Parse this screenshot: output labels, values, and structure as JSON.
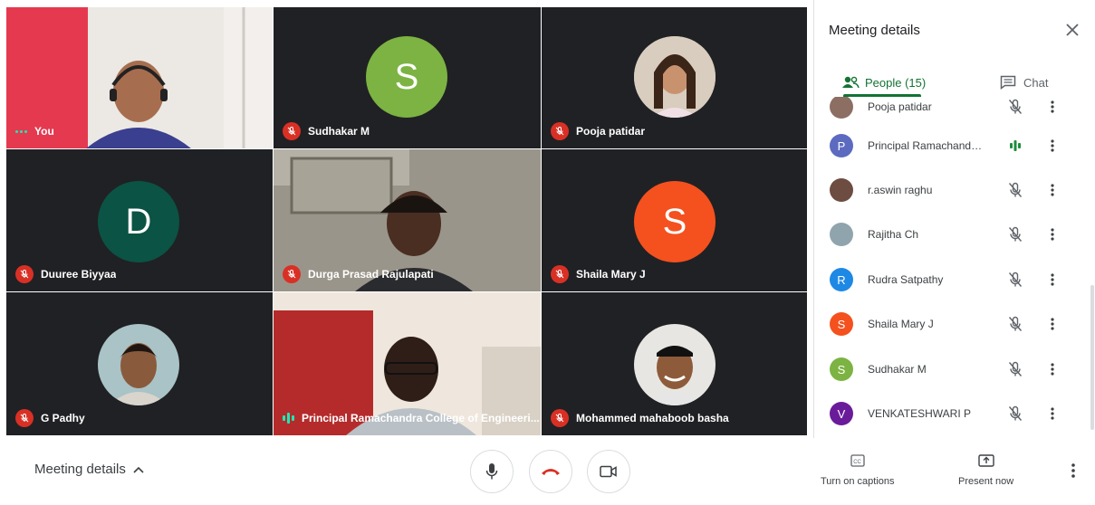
{
  "tiles": {
    "you": {
      "name": "You"
    },
    "sudhakar": {
      "name": "Sudhakar M",
      "initial": "S",
      "color": "#7cb342"
    },
    "pooja": {
      "name": "Pooja patidar"
    },
    "duuree": {
      "name": "Duuree Biyyaa",
      "initial": "D",
      "color": "#0b5344"
    },
    "durga": {
      "name": "Durga Prasad Rajulapati"
    },
    "shaila": {
      "name": "Shaila Mary J",
      "initial": "S",
      "color": "#f4511e"
    },
    "gpadhy": {
      "name": "G Padhy"
    },
    "principal": {
      "name": "Principal Ramachandra College of Engineeri..."
    },
    "mohammed": {
      "name": "Mohammed mahaboob basha"
    }
  },
  "panel": {
    "title": "Meeting details",
    "tab_people": "People (15)",
    "tab_chat": "Chat",
    "people": [
      {
        "name": "Pooja patidar",
        "initial": "",
        "color": "#8d6e63",
        "mic": "muted"
      },
      {
        "name": "Principal Ramachandra ...",
        "initial": "P",
        "color": "#5c6bc0",
        "mic": "speaking"
      },
      {
        "name": "r.aswin raghu",
        "initial": "",
        "color": "#6d4c41",
        "mic": "muted"
      },
      {
        "name": "Rajitha Ch",
        "initial": "",
        "color": "#90a4ae",
        "mic": "muted"
      },
      {
        "name": "Rudra Satpathy",
        "initial": "R",
        "color": "#1e88e5",
        "mic": "muted"
      },
      {
        "name": "Shaila Mary J",
        "initial": "S",
        "color": "#f4511e",
        "mic": "muted"
      },
      {
        "name": "Sudhakar M",
        "initial": "S",
        "color": "#7cb342",
        "mic": "muted"
      },
      {
        "name": "VENKATESHWARI P",
        "initial": "V",
        "color": "#6a1b9a",
        "mic": "muted"
      }
    ]
  },
  "bottom": {
    "meeting_details": "Meeting details",
    "captions": "Turn on captions",
    "present": "Present now"
  },
  "colors": {
    "accent": "#137333",
    "muted": "#d93025",
    "hangup": "#d93025",
    "tile_bg": "#202124"
  }
}
